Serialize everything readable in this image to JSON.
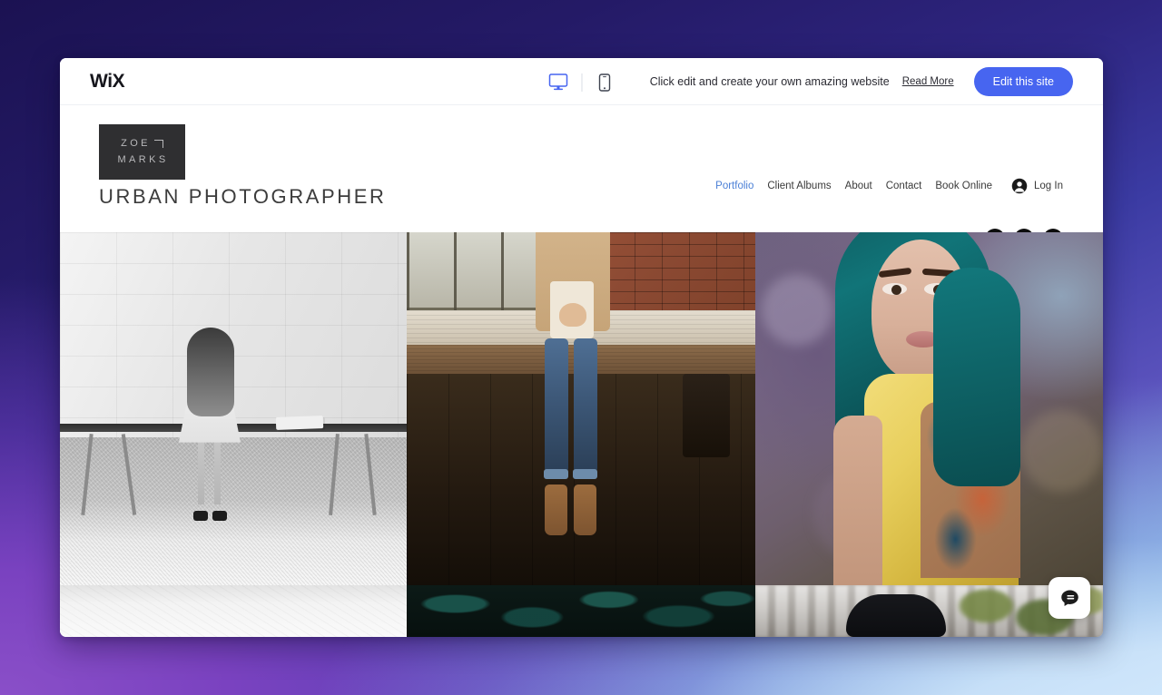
{
  "editor_bar": {
    "logo": "WiX",
    "logo_icon": "wix-logo",
    "desktop_icon": "desktop-monitor-icon",
    "mobile_icon": "mobile-phone-icon",
    "promo_text": "Click edit and create your own amazing website",
    "read_more_label": "Read More",
    "edit_button_label": "Edit this site",
    "accent_color": "#4765f0",
    "active_device": "desktop"
  },
  "site": {
    "brand": {
      "line1": "ZOE",
      "line2": "MARKS",
      "mark_icon": "corner-bracket-icon",
      "block_color": "#2f2f31"
    },
    "title": "URBAN PHOTOGRAPHER",
    "nav": [
      {
        "label": "Portfolio",
        "active": true
      },
      {
        "label": "Client Albums",
        "active": false
      },
      {
        "label": "About",
        "active": false
      },
      {
        "label": "Contact",
        "active": false
      },
      {
        "label": "Book Online",
        "active": false
      }
    ],
    "login": {
      "label": "Log In",
      "avatar_icon": "user-avatar-icon"
    },
    "social": [
      {
        "name": "facebook-icon",
        "label": "Facebook"
      },
      {
        "name": "twitter-icon",
        "label": "Twitter"
      },
      {
        "name": "instagram-icon",
        "label": "Instagram"
      }
    ],
    "active_nav_color": "#4a7fd6"
  },
  "gallery": {
    "items": [
      {
        "name": "photo-girl-on-bench",
        "alt": "Black and white photo of a woman sitting on a bench against a tiled wall"
      },
      {
        "name": "photo-legs-brick-wall",
        "alt": "Woman in jeans and boots sitting on a wooden counter by a brick wall"
      },
      {
        "name": "photo-teal-hair-tattoo",
        "alt": "Portrait of a woman with teal hair, yellow top and shoulder tattoo"
      },
      {
        "name": "photo-white-wall",
        "alt": "Light textured wall"
      },
      {
        "name": "photo-dark-ivy",
        "alt": "Dark green ivy foliage"
      },
      {
        "name": "photo-street-portrait",
        "alt": "Silhouetted head against a blurred street scene"
      }
    ]
  },
  "chat": {
    "icon": "chat-bubble-icon",
    "label": "Chat"
  }
}
